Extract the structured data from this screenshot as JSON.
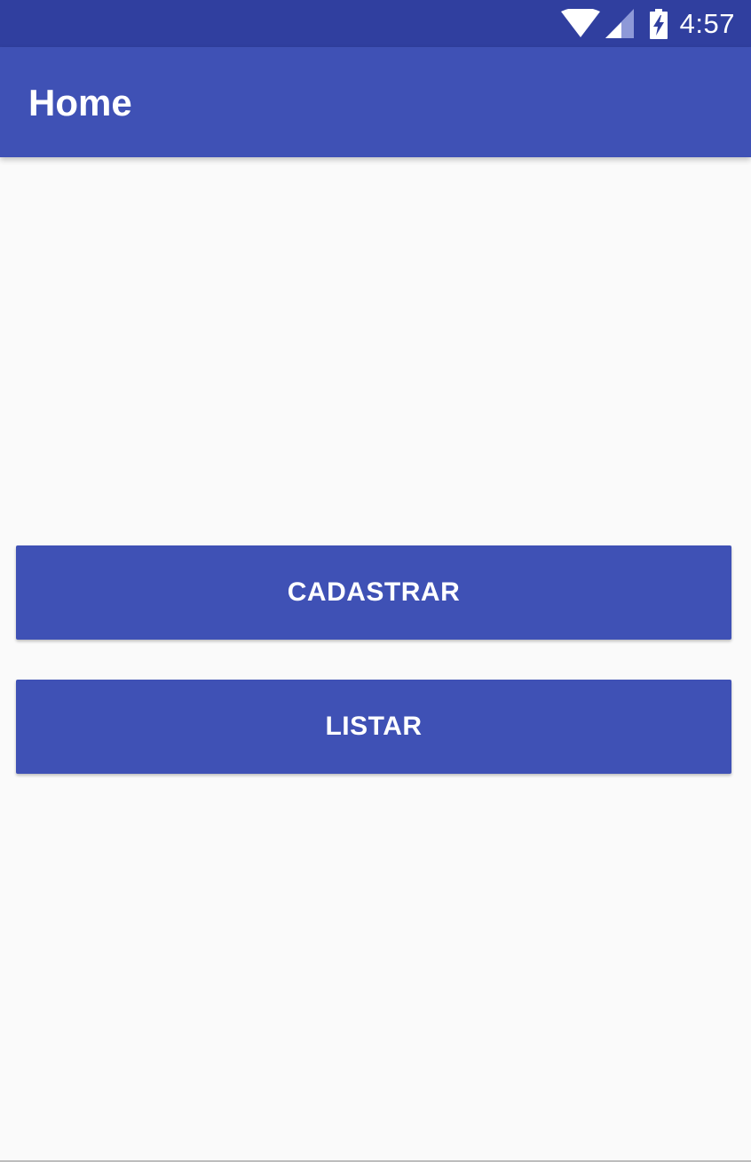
{
  "status_bar": {
    "time": "4:57",
    "icons": [
      "wifi-icon",
      "signal-icon",
      "battery-charging-icon"
    ]
  },
  "app_bar": {
    "title": "Home"
  },
  "main": {
    "buttons": [
      {
        "label": "CADASTRAR"
      },
      {
        "label": "LISTAR"
      }
    ]
  },
  "colors": {
    "primary": "#3f51b5",
    "primary_dark": "#303f9f",
    "background": "#fafafa",
    "text_on_primary": "#ffffff"
  }
}
